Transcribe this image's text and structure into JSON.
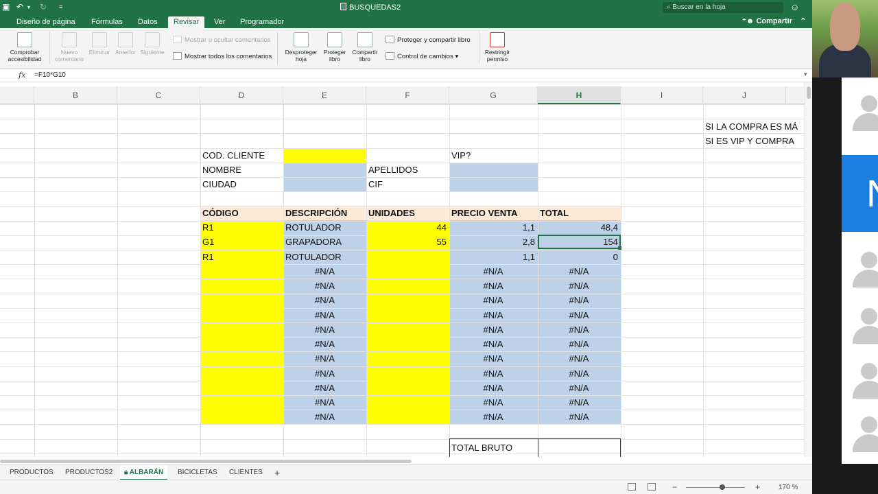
{
  "titlebar": {
    "doc_title": "BUSQUEDAS2",
    "search_placeholder": "Buscar en la hoja"
  },
  "tabs": [
    "Diseño de página",
    "Fórmulas",
    "Datos",
    "Revisar",
    "Ver",
    "Programador"
  ],
  "active_tab": "Revisar",
  "share_label": "Compartir",
  "ribbon": {
    "accesibilidad": "Comprobar accesibilidad",
    "nuevo_comentario": "Nuevo comentario",
    "eliminar": "Eliminar",
    "anterior": "Anterior",
    "siguiente": "Siguiente",
    "mostrar_ocultar": "Mostrar u ocultar comentarios",
    "mostrar_todos": "Mostrar todos los comentarios",
    "desproteger_hoja": "Desproteger hoja",
    "proteger_libro": "Proteger libro",
    "compartir_libro": "Compartir libro",
    "proteger_compartir": "Proteger y compartir libro",
    "control_cambios": "Control de cambios",
    "restringir": "Restringir permiso"
  },
  "formula_bar": {
    "fx": "fx",
    "formula": "=F10*G10"
  },
  "columns": [
    "B",
    "C",
    "D",
    "E",
    "F",
    "G",
    "H",
    "I",
    "J"
  ],
  "selected_column": "H",
  "sheet": {
    "notes": [
      "SI LA COMPRA ES MÁ",
      "SI ES VIP Y COMPRA"
    ],
    "labels": {
      "cod_cliente": "COD. CLIENTE",
      "vip": "VIP?",
      "nombre": "NOMBRE",
      "apellidos": "APELLIDOS",
      "ciudad": "CIUDAD",
      "cif": "CIF"
    },
    "headers": [
      "CÓDIGO",
      "DESCRIPCIÓN",
      "UNIDADES",
      "PRECIO VENTA",
      "TOTAL"
    ],
    "rows": [
      {
        "codigo": "R1",
        "descripcion": "ROTULADOR",
        "unidades": "44",
        "precio": "1,1",
        "total": "48,4"
      },
      {
        "codigo": "G1",
        "descripcion": "GRAPADORA",
        "unidades": "55",
        "precio": "2,8",
        "total": "154"
      },
      {
        "codigo": "R1",
        "descripcion": "ROTULADOR",
        "unidades": "",
        "precio": "1,1",
        "total": "0"
      },
      {
        "codigo": "",
        "descripcion": "#N/A",
        "unidades": "",
        "precio": "#N/A",
        "total": "#N/A"
      },
      {
        "codigo": "",
        "descripcion": "#N/A",
        "unidades": "",
        "precio": "#N/A",
        "total": "#N/A"
      },
      {
        "codigo": "",
        "descripcion": "#N/A",
        "unidades": "",
        "precio": "#N/A",
        "total": "#N/A"
      },
      {
        "codigo": "",
        "descripcion": "#N/A",
        "unidades": "",
        "precio": "#N/A",
        "total": "#N/A"
      },
      {
        "codigo": "",
        "descripcion": "#N/A",
        "unidades": "",
        "precio": "#N/A",
        "total": "#N/A"
      },
      {
        "codigo": "",
        "descripcion": "#N/A",
        "unidades": "",
        "precio": "#N/A",
        "total": "#N/A"
      },
      {
        "codigo": "",
        "descripcion": "#N/A",
        "unidades": "",
        "precio": "#N/A",
        "total": "#N/A"
      },
      {
        "codigo": "",
        "descripcion": "#N/A",
        "unidades": "",
        "precio": "#N/A",
        "total": "#N/A"
      },
      {
        "codigo": "",
        "descripcion": "#N/A",
        "unidades": "",
        "precio": "#N/A",
        "total": "#N/A"
      },
      {
        "codigo": "",
        "descripcion": "#N/A",
        "unidades": "",
        "precio": "#N/A",
        "total": "#N/A"
      },
      {
        "codigo": "",
        "descripcion": "#N/A",
        "unidades": "",
        "precio": "#N/A",
        "total": "#N/A"
      }
    ],
    "total_bruto_label": "TOTAL BRUTO"
  },
  "sheet_tabs": [
    "PRODUCTOS",
    "PRODUCTOS2",
    "ALBARÁN",
    "BICICLETAS",
    "CLIENTES"
  ],
  "active_sheet": "ALBARÁN",
  "zoom": "170 %",
  "zoom_level_fraction": 0.62,
  "video": {
    "participant_initial": "N"
  },
  "colors": {
    "excel_green": "#217346",
    "yellow": "#ffff00",
    "blue_fill": "#bdd1e9",
    "header_fill": "#fde9d5",
    "blue_panel": "#1a7fe0"
  }
}
